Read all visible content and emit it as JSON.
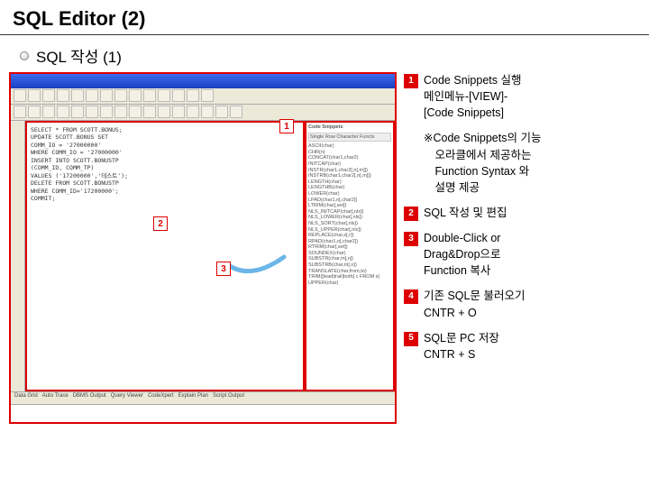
{
  "page_title": "SQL Editor (2)",
  "section_title": "SQL 작성 (1)",
  "markers": {
    "m1": "1",
    "m2": "2",
    "m3": "3"
  },
  "editor_lines": [
    "SELECT * FROM SCOTT.BONUS;",
    "",
    "UPDATE SCOTT.BONUS SET",
    "COMM_IO = '27000000'",
    "WHERE COMM_IO = '27000000'",
    "",
    "INSERT INTO SCOTT.BONUSTP",
    "(COMM_ID, COMM_TP)",
    "VALUES ('17200000','테스트');",
    "",
    "DELETE FROM SCOTT.BONUSTP",
    "WHERE COMM_ID='17200000';",
    "",
    "COMMIT;"
  ],
  "snip_header": "Code Snippets",
  "snip_category": "Single Row Character Functs",
  "snip_items": [
    "ASCII(char)",
    "CHR(n)",
    "CONCAT(char1,char2)",
    "INITCAP(char)",
    "INSTR(char1,char2[,n[,m]])",
    "INSTRB(char1,char2[,n[,m]])",
    "LENGTH(char)",
    "LENGTHB(char)",
    "LOWER(char)",
    "LPAD(char1,n[,char2])",
    "LTRIM(char[,set])",
    "NLS_INITCAP(char[,nls])",
    "NLS_LOWER(char[,nls])",
    "NLS_SORT(char[,nls])",
    "NLS_UPPER(char[,nls])",
    "REPLACE(char,s[,r])",
    "RPAD(char1,n[,char2])",
    "RTRIM(char[,set])",
    "SOUNDEX(char)",
    "SUBSTR(char,m[,n])",
    "SUBSTRB(char,m[,n])",
    "TRANSLATE(char,from,to)",
    "TRIM([lead|trail|both] c FROM s)",
    "UPPER(char)"
  ],
  "tabs": [
    "Data Grid",
    "Auto Trace",
    "DBMS Output",
    "Query Viewer",
    "CodeXpert",
    "Explain Plan",
    "Script Output"
  ],
  "right": {
    "i1": "Code Snippets 실행\n메인메뉴-[VIEW]-\n[Code Snippets]",
    "note": "※Code Snippets의 기능\n　오라클에서 제공하는\n　Function Syntax 와\n　설명 제공",
    "i2": "SQL 작성 및 편집",
    "i3": "Double-Click or\nDrag&Drop으로\nFunction 복사",
    "i4": "기존 SQL문 불러오기\nCNTR + O",
    "i5": "SQL문 PC 저장\nCNTR + S",
    "n1": "1",
    "n2": "2",
    "n3": "3",
    "n4": "4",
    "n5": "5"
  }
}
